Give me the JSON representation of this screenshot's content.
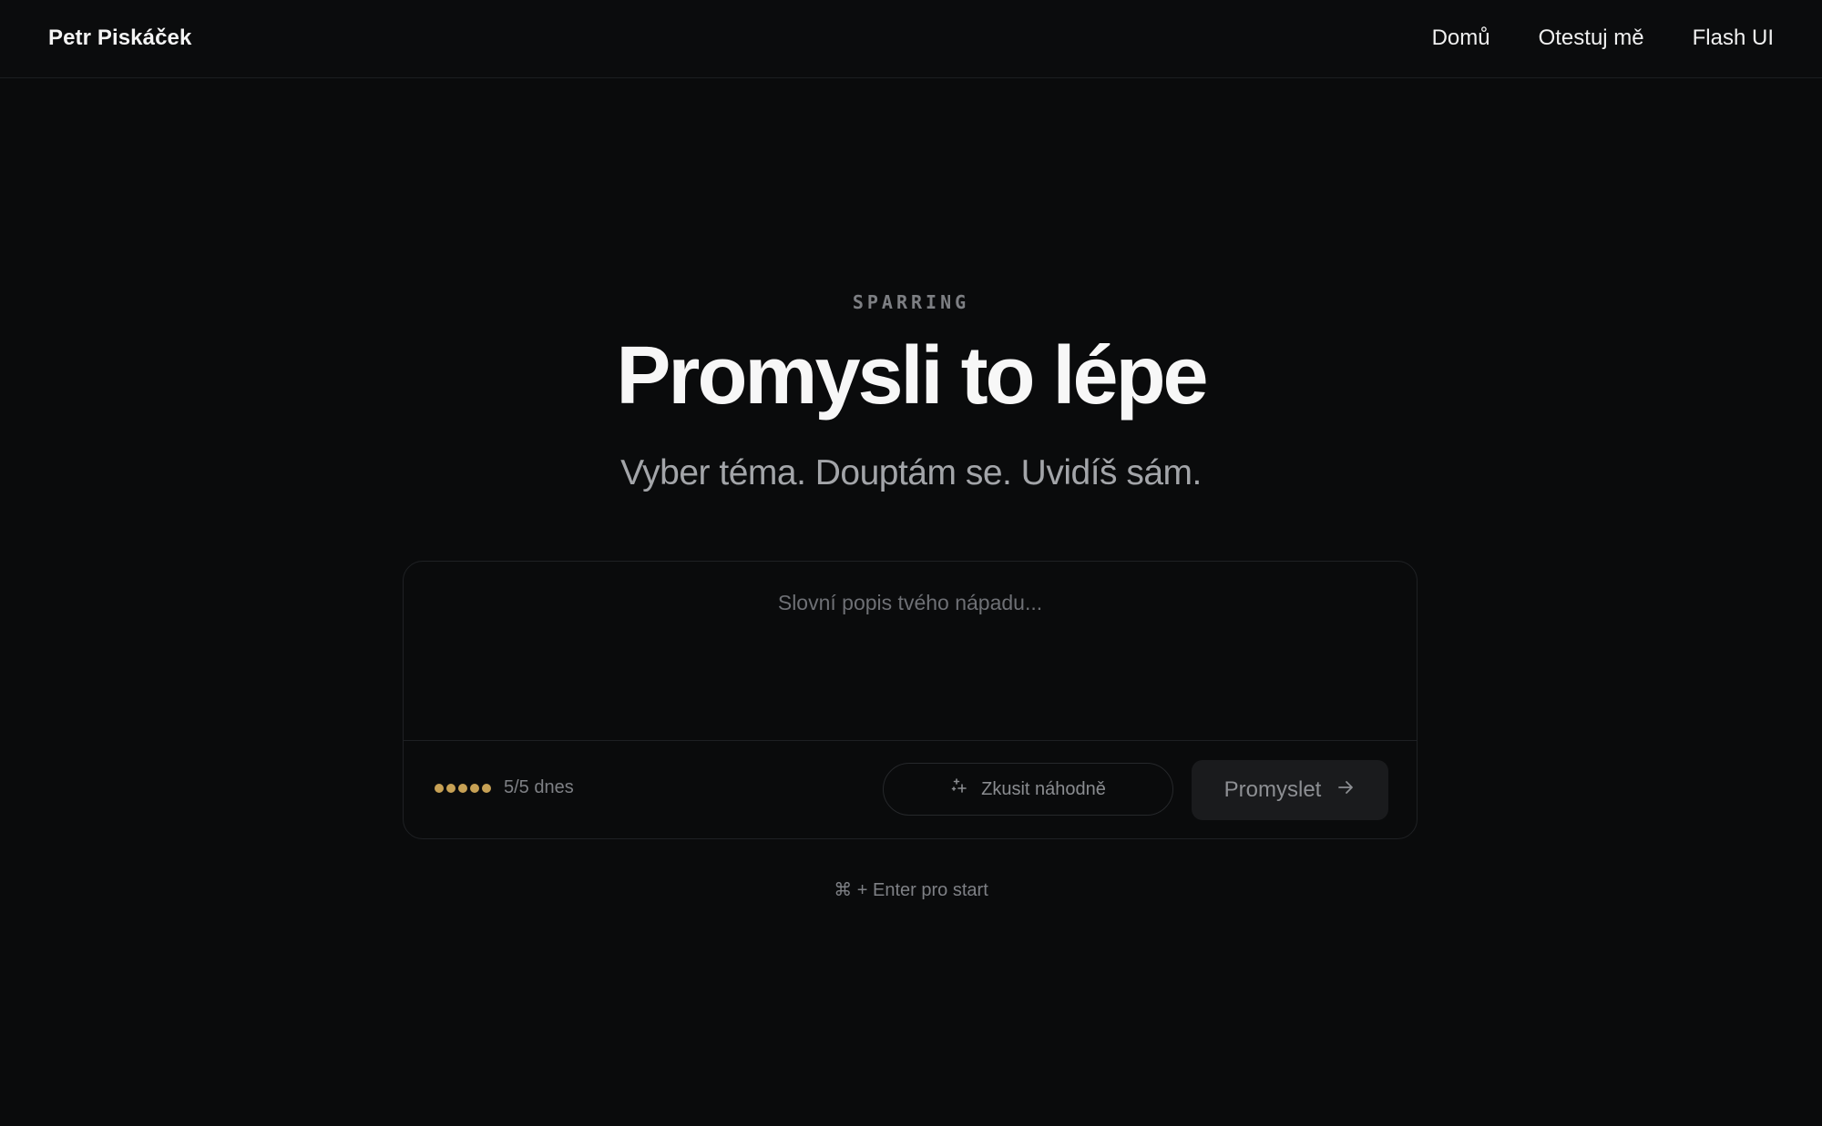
{
  "header": {
    "brand": "Petr Piskáček",
    "nav": [
      "Domů",
      "Otestuj mě",
      "Flash UI"
    ]
  },
  "hero": {
    "eyebrow": "SPARRING",
    "title": "Promysli to lépe",
    "subtitle": "Vyber téma. Douptám se. Uvidíš sám."
  },
  "composer": {
    "placeholder": "Slovní popis tvého nápadu...",
    "value": "",
    "quota": {
      "used": 5,
      "total": 5,
      "label": "5/5 dnes",
      "color": "#c7a155"
    },
    "random_button": {
      "label": "Zkusit náhodně",
      "icon": "sparkle-icon"
    },
    "submit_button": {
      "label": "Promyslet",
      "icon": "arrow-right-icon"
    }
  },
  "hint": "⌘ + Enter pro start"
}
